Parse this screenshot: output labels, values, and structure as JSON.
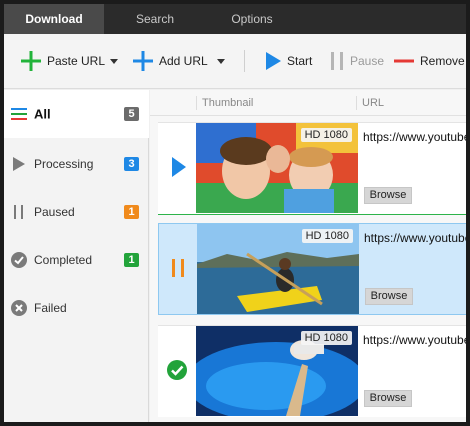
{
  "tabs": [
    {
      "label": "Download",
      "active": true
    },
    {
      "label": "Search",
      "active": false
    },
    {
      "label": "Options",
      "active": false
    }
  ],
  "toolbar": {
    "paste_url_label": "Paste URL",
    "add_url_label": "Add URL",
    "start_label": "Start",
    "pause_label": "Pause",
    "remove_label": "Remove"
  },
  "sidebar": {
    "items": [
      {
        "label": "All",
        "count": "5",
        "badge_color": "#6b6b6b",
        "icon": "list-icon"
      },
      {
        "label": "Processing",
        "count": "3",
        "badge_color": "#1e88e5",
        "icon": "play-icon"
      },
      {
        "label": "Paused",
        "count": "1",
        "badge_color": "#f08a1c",
        "icon": "pause-icon"
      },
      {
        "label": "Completed",
        "count": "1",
        "badge_color": "#22a33a",
        "icon": "check-icon"
      },
      {
        "label": "Failed",
        "count": "",
        "icon": "x-circle-icon"
      }
    ]
  },
  "columns": {
    "thumbnail": "Thumbnail",
    "url": "URL"
  },
  "downloads": [
    {
      "status": "processing",
      "quality": "HD 1080",
      "url": "https://www.youtube",
      "browse_label": "Browse"
    },
    {
      "status": "paused",
      "quality": "HD 1080",
      "url": "https://www.youtube",
      "browse_label": "Browse"
    },
    {
      "status": "completed",
      "quality": "HD 1080",
      "url": "https://www.youtube",
      "browse_label": "Browse"
    }
  ],
  "colors": {
    "accent_blue": "#1e88e5",
    "accent_orange": "#f08a1c",
    "accent_green": "#22a33a",
    "remove_red": "#e53935"
  }
}
